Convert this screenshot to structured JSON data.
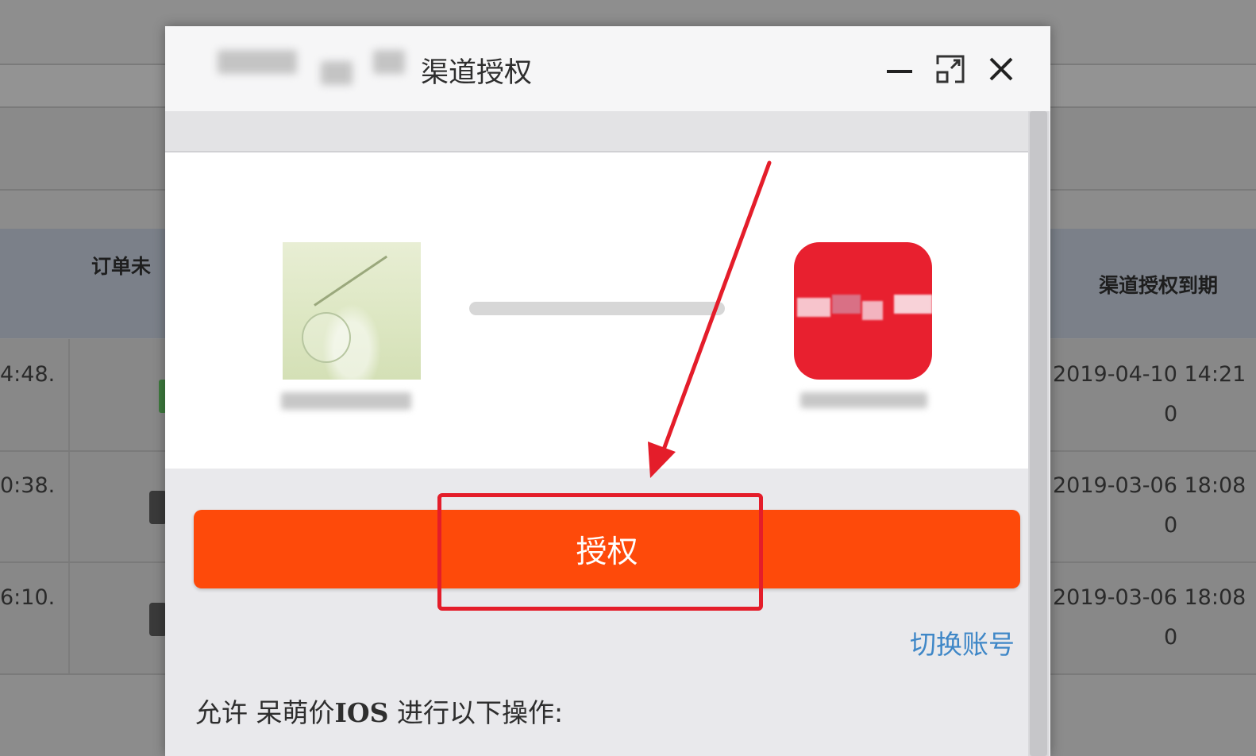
{
  "background_table": {
    "headers": [
      "订单未",
      "渠道授权到期"
    ],
    "rows": [
      {
        "left": "4:48.",
        "right": "2019-04-10 14:21",
        "right_sub": "0"
      },
      {
        "left": "0:38.",
        "right": "2019-03-06 18:08",
        "right_sub": "0"
      },
      {
        "left": "6:10.",
        "right": "2019-03-06 18:08",
        "right_sub": "0"
      }
    ]
  },
  "dialog": {
    "title": "渠道授权",
    "controls": {
      "minimize": "minimize-icon",
      "maximize": "maximize-icon",
      "close": "close-icon"
    },
    "authorize_label": "授权",
    "switch_account_label": "切换账号",
    "permission_prefix": "允许 呆萌价",
    "permission_app": "IOS",
    "permission_suffix": " 进行以下操作:"
  },
  "colors": {
    "authorize_button": "#fe4a0a",
    "link": "#3f87c7",
    "annotation": "#e41d2a",
    "app_icon": "#e8202f"
  }
}
